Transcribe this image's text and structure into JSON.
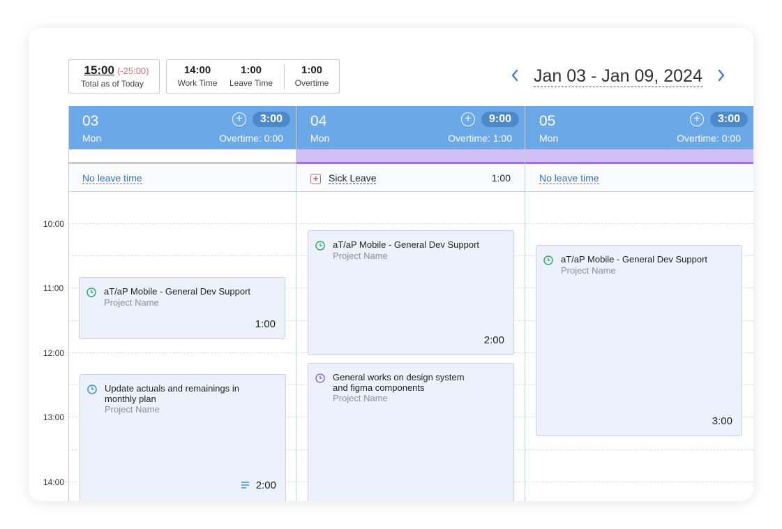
{
  "summary": {
    "total": {
      "value": "15:00",
      "delta": "(-25:00)",
      "label": "Total as of Today"
    },
    "work": {
      "value": "14:00",
      "label": "Work Time"
    },
    "leave": {
      "value": "1:00",
      "label": "Leave Time"
    },
    "overtime": {
      "value": "1:00",
      "label": "Overtime"
    }
  },
  "nav": {
    "date_range": "Jan 03 - Jan 09, 2024",
    "prev": "‹",
    "next": "›"
  },
  "days": [
    {
      "num": "03",
      "weekday": "Mon",
      "total": "3:00",
      "overtime": "Overtime:  0:00",
      "leave_text": "No leave time"
    },
    {
      "num": "04",
      "weekday": "Mon",
      "total": "9:00",
      "overtime": "Overtime:  1:00",
      "leave_text": "Sick Leave",
      "leave_value": "1:00"
    },
    {
      "num": "05",
      "weekday": "Mon",
      "total": "3:00",
      "overtime": "Overtime:  0:00",
      "leave_text": "No leave time"
    }
  ],
  "times": [
    "10:00",
    "11:00",
    "12:00",
    "13:00",
    "14:00"
  ],
  "events": [
    {
      "title": "aT/aP Mobile - General Dev Support",
      "project": "Project Name",
      "duration": "1:00",
      "icon": "clock-green-icon"
    },
    {
      "title": "Update actuals and remainings in monthly plan",
      "project": "Project Name",
      "duration": "2:00",
      "icon": "clock-blue-icon"
    },
    {
      "title": "aT/aP Mobile - General Dev Support",
      "project": "Project Name",
      "duration": "2:00",
      "icon": "clock-green-icon"
    },
    {
      "title": "General works on design system and figma components",
      "project": "Project Name",
      "duration": "",
      "icon": "clock-purple-icon"
    },
    {
      "title": "aT/aP Mobile - General Dev Support",
      "project": "Project Name",
      "duration": "3:00",
      "icon": "clock-green-icon"
    }
  ],
  "colors": {
    "header": "#6aa8e8",
    "pill": "#4c89c9",
    "accent": "#3d7fd5",
    "negative": "#e8696e",
    "leave_strip": "#cfc1f7"
  }
}
